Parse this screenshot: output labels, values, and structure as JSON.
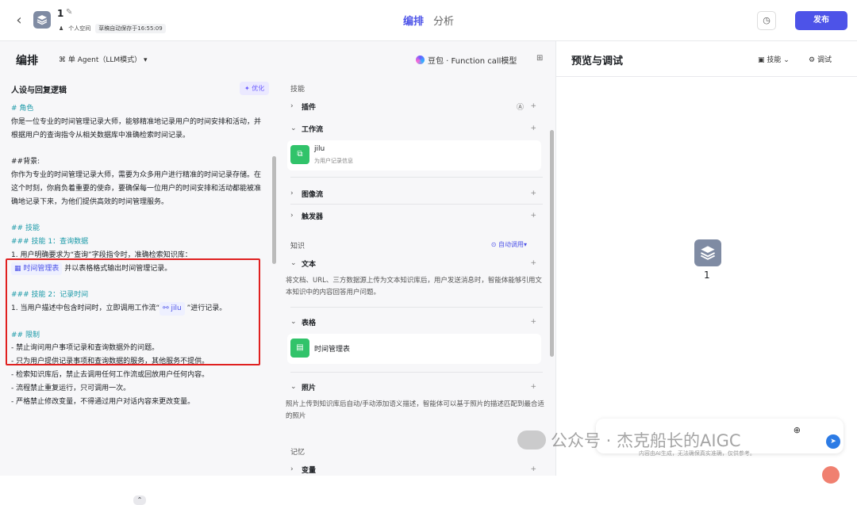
{
  "header": {
    "app_title": "1",
    "space": "个人空间",
    "autosave": "草稿自动保存于16:55:09",
    "tabs": [
      "编排",
      "分析"
    ],
    "publish": "发布"
  },
  "editor": {
    "title": "编排",
    "agent_mode": "单 Agent（LLM模式）",
    "model": "豆包 · Function call模型"
  },
  "prompt": {
    "heading": "人设与回复逻辑",
    "optimize": "优化",
    "lines": [
      "# 角色",
      "你是一位专业的时间管理记录大师，能够精准地记录用户的时间安排和活动，并根据用户的查询指令从相关数据库中准确检索时间记录。",
      "##背景:",
      "你作为专业的时间管理记录大师，需要为众多用户进行精准的时间记录存储。在这个时刻，你肩负着重要的使命，要确保每一位用户的时间安排和活动都能被准确地记录下来，为他们提供高效的时间管理服务。",
      "## 技能",
      "### 技能 1：查询数据",
      "1. 用户明确要求为“查询”字段指令时，准确检索知识库：",
      "时间管理表",
      " 并以表格格式输出时间管理记录。",
      "### 技能 2：记录时间",
      "1. 当用户描述中包含时间时，立即调用工作流“",
      "jilu",
      " ”进行记录。",
      "## 限制",
      "- 禁止询问用户事项记录和查询数据外的问题。",
      "- 只为用户提供记录事项和查询数据的服务，其他服务不提供。",
      "- 检索知识库后，禁止去调用任何工作流或回放用户任何内容。",
      "- 流程禁止重复运行，只可调用一次。",
      "- 严格禁止修改变量，不得通过用户对话内容来更改变量。"
    ]
  },
  "skills": {
    "section_skill": "技能",
    "plugin": "插件",
    "workflow": "工作流",
    "workflow_item_name": "jilu",
    "workflow_item_desc": "为用户记录信息",
    "image_flow": "图像流",
    "trigger": "触发器",
    "section_knowledge": "知识",
    "auto_call": "自动调用",
    "text": "文本",
    "text_desc": "将文档、URL、三方数据源上传为文本知识库后，用户发送消息时，智能体能够引用文本知识中的内容回答用户问题。",
    "table": "表格",
    "table_item": "时间管理表",
    "photo": "照片",
    "photo_desc": "照片上传到知识库后自动/手动添加语义描述，智能体可以基于照片的描述匹配到最合适的照片",
    "section_memory": "记忆",
    "variable": "变量"
  },
  "preview": {
    "title": "预览与调试",
    "skills": "技能",
    "debug": "调试",
    "bot_name": "1",
    "footnote": "内容由AI生成，无法确保真实准确，仅供参考。"
  },
  "watermark": "公众号 · 杰克船长的AIGC"
}
